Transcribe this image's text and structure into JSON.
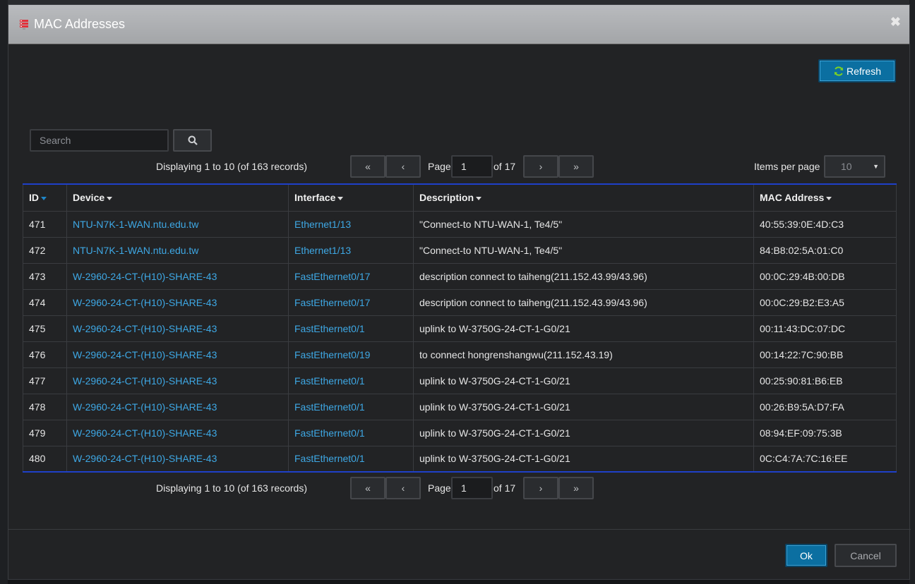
{
  "dialog": {
    "title": "MAC Addresses",
    "close_glyph": "✖",
    "title_icon": "server-rack-icon"
  },
  "toolbar": {
    "refresh_label": "Refresh"
  },
  "search": {
    "placeholder": "Search",
    "value": ""
  },
  "pager_top": {
    "records": "Displaying 1 to 10 (of 163 records)",
    "first": "«",
    "prev": "‹",
    "page_label": "Page",
    "page_value": "1",
    "of_label": "of 17",
    "next": "›",
    "last": "»"
  },
  "pager_bottom": {
    "records": "Displaying 1 to 10 (of 163 records)",
    "first": "«",
    "prev": "‹",
    "page_label": "Page",
    "page_value": "1",
    "of_label": "of 17",
    "next": "›",
    "last": "»"
  },
  "items_per_page": {
    "label": "Items per page",
    "value": "10"
  },
  "table": {
    "columns": [
      "ID",
      "Device",
      "Interface",
      "Description",
      "MAC Address"
    ],
    "rows": [
      {
        "id": "471",
        "device": "NTU-N7K-1-WAN.ntu.edu.tw",
        "interface": "Ethernet1/13",
        "description": "\"Connect-to NTU-WAN-1, Te4/5\"",
        "mac": "40:55:39:0E:4D:C3"
      },
      {
        "id": "472",
        "device": "NTU-N7K-1-WAN.ntu.edu.tw",
        "interface": "Ethernet1/13",
        "description": "\"Connect-to NTU-WAN-1, Te4/5\"",
        "mac": "84:B8:02:5A:01:C0"
      },
      {
        "id": "473",
        "device": "W-2960-24-CT-(H10)-SHARE-43",
        "interface": "FastEthernet0/17",
        "description": "description connect to taiheng(211.152.43.99/43.96)",
        "mac": "00:0C:29:4B:00:DB"
      },
      {
        "id": "474",
        "device": "W-2960-24-CT-(H10)-SHARE-43",
        "interface": "FastEthernet0/17",
        "description": "description connect to taiheng(211.152.43.99/43.96)",
        "mac": "00:0C:29:B2:E3:A5"
      },
      {
        "id": "475",
        "device": "W-2960-24-CT-(H10)-SHARE-43",
        "interface": "FastEthernet0/1",
        "description": "uplink to W-3750G-24-CT-1-G0/21",
        "mac": "00:11:43:DC:07:DC"
      },
      {
        "id": "476",
        "device": "W-2960-24-CT-(H10)-SHARE-43",
        "interface": "FastEthernet0/19",
        "description": "to connect hongrenshangwu(211.152.43.19)",
        "mac": "00:14:22:7C:90:BB"
      },
      {
        "id": "477",
        "device": "W-2960-24-CT-(H10)-SHARE-43",
        "interface": "FastEthernet0/1",
        "description": "uplink to W-3750G-24-CT-1-G0/21",
        "mac": "00:25:90:81:B6:EB"
      },
      {
        "id": "478",
        "device": "W-2960-24-CT-(H10)-SHARE-43",
        "interface": "FastEthernet0/1",
        "description": "uplink to W-3750G-24-CT-1-G0/21",
        "mac": "00:26:B9:5A:D7:FA"
      },
      {
        "id": "479",
        "device": "W-2960-24-CT-(H10)-SHARE-43",
        "interface": "FastEthernet0/1",
        "description": "uplink to W-3750G-24-CT-1-G0/21",
        "mac": "08:94:EF:09:75:3B"
      },
      {
        "id": "480",
        "device": "W-2960-24-CT-(H10)-SHARE-43",
        "interface": "FastEthernet0/1",
        "description": "uplink to W-3750G-24-CT-1-G0/21",
        "mac": "0C:C4:7A:7C:16:EE"
      }
    ]
  },
  "footer": {
    "ok_label": "Ok",
    "cancel_label": "Cancel"
  },
  "colors": {
    "accent": "#0b6fa1",
    "link": "#3ea8e5",
    "table_border_accent": "#1f40c9"
  }
}
